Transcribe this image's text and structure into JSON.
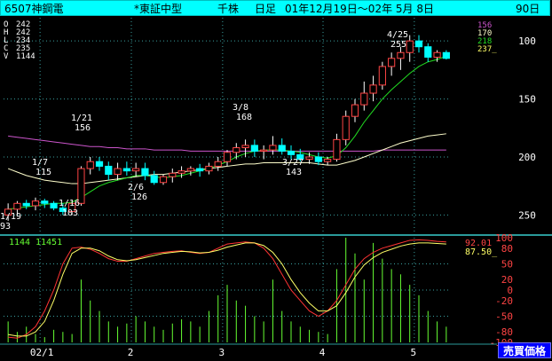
{
  "header": {
    "code_name": "6507神鋼電",
    "market": "*東証中型",
    "unit": "千株",
    "period_label": "日足",
    "range": "01年12月19日～02年 5月 8日",
    "days": "90日"
  },
  "ohlcv": {
    "o_label": "O",
    "o_value": "242",
    "h_label": "H",
    "h_value": "242",
    "l_label": "L",
    "l_value": "234",
    "c_label": "C",
    "c_value": "235",
    "v_label": "V",
    "v_value": "1144"
  },
  "ma_values": {
    "ma1": "156",
    "ma2": "170",
    "ma3": "218",
    "ma4": "237_"
  },
  "annotations": [
    {
      "label": "1/19",
      "value": "93"
    },
    {
      "label": "1/7",
      "value": "115"
    },
    {
      "label": "1/16",
      "value": "103"
    },
    {
      "label": "1/21",
      "value": "156"
    },
    {
      "label": "2/6",
      "value": "126"
    },
    {
      "label": "3/8",
      "value": "168"
    },
    {
      "label": "3/27",
      "value": "143"
    },
    {
      "label": "4/25",
      "value": "255"
    }
  ],
  "price_axis": [
    "250",
    "200",
    "150",
    "100"
  ],
  "oscillator": {
    "volume_text": "1144",
    "volume_text2": "11451",
    "k_value": "92.01",
    "d_value": "87.50_",
    "axis": [
      "100",
      "80",
      "50",
      "20",
      "0",
      "-20",
      "-50",
      "-80",
      "-100"
    ]
  },
  "x_axis": [
    "02/1",
    "2",
    "3",
    "4",
    "5"
  ],
  "sell_button_label": "売買価格",
  "colors": {
    "background": "#000000",
    "title_bg": "#00ffff",
    "candle_up": "#ffffff",
    "candle_down": "#00ffff",
    "ma_short": "#22dd22",
    "ma_mid": "#ffffcc",
    "ma_long": "#cc55cc",
    "volume": "#66ff33",
    "osc_k": "#ff3333",
    "osc_d": "#ffff66"
  },
  "chart_data": [
    {
      "type": "candlestick",
      "title": "6507神鋼電 日足",
      "ylim": [
        85,
        270
      ],
      "yticks": [
        100,
        150,
        200,
        250
      ],
      "candles": [
        [
          100,
          110,
          95,
          105
        ],
        [
          105,
          112,
          100,
          110
        ],
        [
          110,
          113,
          105,
          108
        ],
        [
          108,
          115,
          104,
          112
        ],
        [
          112,
          114,
          106,
          110
        ],
        [
          110,
          112,
          104,
          106
        ],
        [
          106,
          110,
          100,
          103
        ],
        [
          103,
          112,
          100,
          110
        ],
        [
          110,
          142,
          108,
          140
        ],
        [
          140,
          150,
          135,
          146
        ],
        [
          146,
          150,
          138,
          142
        ],
        [
          142,
          146,
          130,
          135
        ],
        [
          135,
          145,
          130,
          140
        ],
        [
          140,
          146,
          134,
          138
        ],
        [
          138,
          145,
          133,
          140
        ],
        [
          140,
          145,
          130,
          134
        ],
        [
          134,
          138,
          126,
          128
        ],
        [
          128,
          135,
          126,
          133
        ],
        [
          133,
          140,
          128,
          136
        ],
        [
          136,
          142,
          132,
          138
        ],
        [
          138,
          142,
          134,
          140
        ],
        [
          140,
          144,
          133,
          138
        ],
        [
          138,
          145,
          135,
          142
        ],
        [
          142,
          150,
          138,
          146
        ],
        [
          146,
          156,
          142,
          154
        ],
        [
          154,
          162,
          148,
          158
        ],
        [
          158,
          165,
          150,
          160
        ],
        [
          160,
          165,
          150,
          155
        ],
        [
          155,
          160,
          148,
          156
        ],
        [
          156,
          168,
          152,
          160
        ],
        [
          160,
          166,
          152,
          155
        ],
        [
          155,
          160,
          148,
          152
        ],
        [
          152,
          157,
          146,
          148
        ],
        [
          148,
          154,
          144,
          150
        ],
        [
          150,
          154,
          143,
          146
        ],
        [
          146,
          150,
          143,
          148
        ],
        [
          148,
          170,
          146,
          165
        ],
        [
          165,
          190,
          160,
          185
        ],
        [
          185,
          200,
          180,
          195
        ],
        [
          195,
          215,
          190,
          205
        ],
        [
          205,
          220,
          198,
          212
        ],
        [
          212,
          232,
          208,
          228
        ],
        [
          228,
          240,
          220,
          235
        ],
        [
          235,
          245,
          225,
          240
        ],
        [
          240,
          255,
          232,
          250
        ],
        [
          250,
          255,
          240,
          245
        ],
        [
          245,
          248,
          232,
          236
        ],
        [
          236,
          242,
          232,
          240
        ],
        [
          240,
          242,
          234,
          235
        ]
      ],
      "ma_short": [
        105,
        106,
        107,
        108,
        109,
        110,
        110,
        111,
        115,
        120,
        125,
        128,
        130,
        132,
        134,
        134,
        133,
        132,
        133,
        134,
        136,
        138,
        140,
        143,
        146,
        150,
        153,
        155,
        156,
        156,
        156,
        155,
        154,
        152,
        150,
        149,
        151,
        158,
        168,
        180,
        190,
        200,
        208,
        215,
        222,
        228,
        232,
        234,
        237
      ],
      "ma_mid": [
        140,
        137,
        134,
        132,
        130,
        129,
        128,
        127,
        127,
        128,
        129,
        130,
        131,
        132,
        133,
        134,
        135,
        135,
        136,
        137,
        138,
        139,
        140,
        141,
        142,
        143,
        144,
        144,
        145,
        145,
        145,
        145,
        145,
        145,
        144,
        143,
        143,
        145,
        147,
        150,
        153,
        156,
        159,
        162,
        164,
        166,
        168,
        169,
        170
      ],
      "ma_long": [
        168,
        167,
        166,
        165,
        164,
        163,
        162,
        161,
        160,
        159,
        159,
        158,
        158,
        157,
        157,
        157,
        156,
        156,
        156,
        156,
        155,
        155,
        155,
        155,
        155,
        155,
        155,
        155,
        155,
        155,
        155,
        155,
        155,
        155,
        155,
        155,
        155,
        155,
        155,
        155,
        155,
        156,
        156,
        156,
        156,
        156,
        156,
        156,
        156
      ]
    },
    {
      "type": "line",
      "title": "oscillator",
      "ylim": [
        -100,
        100
      ],
      "series": [
        {
          "name": "92.01",
          "values": [
            -90,
            -92,
            -85,
            -70,
            -40,
            0,
            50,
            80,
            82,
            78,
            70,
            60,
            55,
            55,
            60,
            65,
            70,
            72,
            74,
            75,
            72,
            70,
            72,
            80,
            88,
            90,
            92,
            90,
            80,
            60,
            30,
            0,
            -20,
            -40,
            -50,
            -40,
            -20,
            10,
            40,
            60,
            72,
            80,
            85,
            90,
            95,
            96,
            95,
            93,
            92
          ]
        },
        {
          "name": "87.50_",
          "values": [
            -85,
            -88,
            -88,
            -80,
            -60,
            -20,
            30,
            70,
            80,
            80,
            75,
            65,
            58,
            56,
            58,
            62,
            66,
            70,
            72,
            74,
            73,
            71,
            72,
            76,
            82,
            86,
            90,
            90,
            85,
            72,
            50,
            20,
            -5,
            -25,
            -40,
            -40,
            -30,
            -5,
            25,
            48,
            62,
            72,
            78,
            84,
            88,
            90,
            90,
            89,
            88
          ]
        }
      ],
      "volume": [
        20,
        10,
        15,
        8,
        5,
        12,
        10,
        8,
        60,
        40,
        30,
        20,
        15,
        18,
        25,
        20,
        15,
        12,
        18,
        22,
        20,
        15,
        30,
        45,
        55,
        40,
        35,
        25,
        20,
        60,
        30,
        20,
        15,
        12,
        10,
        8,
        70,
        100,
        85,
        60,
        95,
        80,
        70,
        65,
        55,
        45,
        30,
        20,
        15
      ]
    }
  ]
}
